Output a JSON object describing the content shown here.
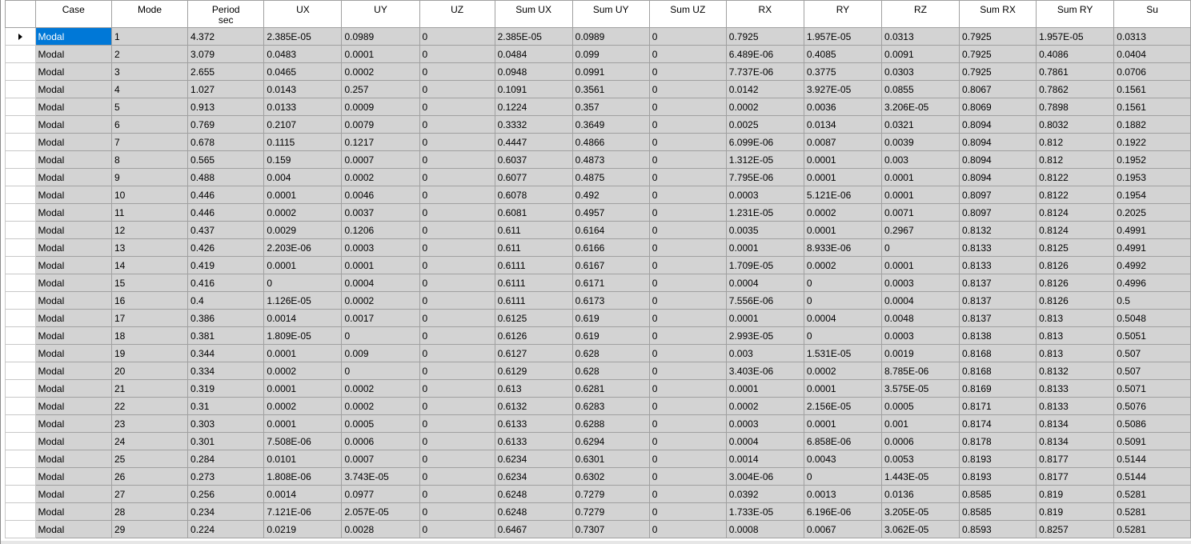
{
  "table": {
    "columns": [
      {
        "label": "Case",
        "sub": ""
      },
      {
        "label": "Mode",
        "sub": ""
      },
      {
        "label": "Period",
        "sub": "sec"
      },
      {
        "label": "UX",
        "sub": ""
      },
      {
        "label": "UY",
        "sub": ""
      },
      {
        "label": "UZ",
        "sub": ""
      },
      {
        "label": "Sum UX",
        "sub": ""
      },
      {
        "label": "Sum UY",
        "sub": ""
      },
      {
        "label": "Sum UZ",
        "sub": ""
      },
      {
        "label": "RX",
        "sub": ""
      },
      {
        "label": "RY",
        "sub": ""
      },
      {
        "label": "RZ",
        "sub": ""
      },
      {
        "label": "Sum RX",
        "sub": ""
      },
      {
        "label": "Sum RY",
        "sub": ""
      },
      {
        "label": "Su",
        "sub": ""
      }
    ],
    "rows": [
      [
        "Modal",
        "1",
        "4.372",
        "2.385E-05",
        "0.0989",
        "0",
        "2.385E-05",
        "0.0989",
        "0",
        "0.7925",
        "1.957E-05",
        "0.0313",
        "0.7925",
        "1.957E-05",
        "0.0313"
      ],
      [
        "Modal",
        "2",
        "3.079",
        "0.0483",
        "0.0001",
        "0",
        "0.0484",
        "0.099",
        "0",
        "6.489E-06",
        "0.4085",
        "0.0091",
        "0.7925",
        "0.4086",
        "0.0404"
      ],
      [
        "Modal",
        "3",
        "2.655",
        "0.0465",
        "0.0002",
        "0",
        "0.0948",
        "0.0991",
        "0",
        "7.737E-06",
        "0.3775",
        "0.0303",
        "0.7925",
        "0.7861",
        "0.0706"
      ],
      [
        "Modal",
        "4",
        "1.027",
        "0.0143",
        "0.257",
        "0",
        "0.1091",
        "0.3561",
        "0",
        "0.0142",
        "3.927E-05",
        "0.0855",
        "0.8067",
        "0.7862",
        "0.1561"
      ],
      [
        "Modal",
        "5",
        "0.913",
        "0.0133",
        "0.0009",
        "0",
        "0.1224",
        "0.357",
        "0",
        "0.0002",
        "0.0036",
        "3.206E-05",
        "0.8069",
        "0.7898",
        "0.1561"
      ],
      [
        "Modal",
        "6",
        "0.769",
        "0.2107",
        "0.0079",
        "0",
        "0.3332",
        "0.3649",
        "0",
        "0.0025",
        "0.0134",
        "0.0321",
        "0.8094",
        "0.8032",
        "0.1882"
      ],
      [
        "Modal",
        "7",
        "0.678",
        "0.1115",
        "0.1217",
        "0",
        "0.4447",
        "0.4866",
        "0",
        "6.099E-06",
        "0.0087",
        "0.0039",
        "0.8094",
        "0.812",
        "0.1922"
      ],
      [
        "Modal",
        "8",
        "0.565",
        "0.159",
        "0.0007",
        "0",
        "0.6037",
        "0.4873",
        "0",
        "1.312E-05",
        "0.0001",
        "0.003",
        "0.8094",
        "0.812",
        "0.1952"
      ],
      [
        "Modal",
        "9",
        "0.488",
        "0.004",
        "0.0002",
        "0",
        "0.6077",
        "0.4875",
        "0",
        "7.795E-06",
        "0.0001",
        "0.0001",
        "0.8094",
        "0.8122",
        "0.1953"
      ],
      [
        "Modal",
        "10",
        "0.446",
        "0.0001",
        "0.0046",
        "0",
        "0.6078",
        "0.492",
        "0",
        "0.0003",
        "5.121E-06",
        "0.0001",
        "0.8097",
        "0.8122",
        "0.1954"
      ],
      [
        "Modal",
        "11",
        "0.446",
        "0.0002",
        "0.0037",
        "0",
        "0.6081",
        "0.4957",
        "0",
        "1.231E-05",
        "0.0002",
        "0.0071",
        "0.8097",
        "0.8124",
        "0.2025"
      ],
      [
        "Modal",
        "12",
        "0.437",
        "0.0029",
        "0.1206",
        "0",
        "0.611",
        "0.6164",
        "0",
        "0.0035",
        "0.0001",
        "0.2967",
        "0.8132",
        "0.8124",
        "0.4991"
      ],
      [
        "Modal",
        "13",
        "0.426",
        "2.203E-06",
        "0.0003",
        "0",
        "0.611",
        "0.6166",
        "0",
        "0.0001",
        "8.933E-06",
        "0",
        "0.8133",
        "0.8125",
        "0.4991"
      ],
      [
        "Modal",
        "14",
        "0.419",
        "0.0001",
        "0.0001",
        "0",
        "0.6111",
        "0.6167",
        "0",
        "1.709E-05",
        "0.0002",
        "0.0001",
        "0.8133",
        "0.8126",
        "0.4992"
      ],
      [
        "Modal",
        "15",
        "0.416",
        "0",
        "0.0004",
        "0",
        "0.6111",
        "0.6171",
        "0",
        "0.0004",
        "0",
        "0.0003",
        "0.8137",
        "0.8126",
        "0.4996"
      ],
      [
        "Modal",
        "16",
        "0.4",
        "1.126E-05",
        "0.0002",
        "0",
        "0.6111",
        "0.6173",
        "0",
        "7.556E-06",
        "0",
        "0.0004",
        "0.8137",
        "0.8126",
        "0.5"
      ],
      [
        "Modal",
        "17",
        "0.386",
        "0.0014",
        "0.0017",
        "0",
        "0.6125",
        "0.619",
        "0",
        "0.0001",
        "0.0004",
        "0.0048",
        "0.8137",
        "0.813",
        "0.5048"
      ],
      [
        "Modal",
        "18",
        "0.381",
        "1.809E-05",
        "0",
        "0",
        "0.6126",
        "0.619",
        "0",
        "2.993E-05",
        "0",
        "0.0003",
        "0.8138",
        "0.813",
        "0.5051"
      ],
      [
        "Modal",
        "19",
        "0.344",
        "0.0001",
        "0.009",
        "0",
        "0.6127",
        "0.628",
        "0",
        "0.003",
        "1.531E-05",
        "0.0019",
        "0.8168",
        "0.813",
        "0.507"
      ],
      [
        "Modal",
        "20",
        "0.334",
        "0.0002",
        "0",
        "0",
        "0.6129",
        "0.628",
        "0",
        "3.403E-06",
        "0.0002",
        "8.785E-06",
        "0.8168",
        "0.8132",
        "0.507"
      ],
      [
        "Modal",
        "21",
        "0.319",
        "0.0001",
        "0.0002",
        "0",
        "0.613",
        "0.6281",
        "0",
        "0.0001",
        "0.0001",
        "3.575E-05",
        "0.8169",
        "0.8133",
        "0.5071"
      ],
      [
        "Modal",
        "22",
        "0.31",
        "0.0002",
        "0.0002",
        "0",
        "0.6132",
        "0.6283",
        "0",
        "0.0002",
        "2.156E-05",
        "0.0005",
        "0.8171",
        "0.8133",
        "0.5076"
      ],
      [
        "Modal",
        "23",
        "0.303",
        "0.0001",
        "0.0005",
        "0",
        "0.6133",
        "0.6288",
        "0",
        "0.0003",
        "0.0001",
        "0.001",
        "0.8174",
        "0.8134",
        "0.5086"
      ],
      [
        "Modal",
        "24",
        "0.301",
        "7.508E-06",
        "0.0006",
        "0",
        "0.6133",
        "0.6294",
        "0",
        "0.0004",
        "6.858E-06",
        "0.0006",
        "0.8178",
        "0.8134",
        "0.5091"
      ],
      [
        "Modal",
        "25",
        "0.284",
        "0.0101",
        "0.0007",
        "0",
        "0.6234",
        "0.6301",
        "0",
        "0.0014",
        "0.0043",
        "0.0053",
        "0.8193",
        "0.8177",
        "0.5144"
      ],
      [
        "Modal",
        "26",
        "0.273",
        "1.808E-06",
        "3.743E-05",
        "0",
        "0.6234",
        "0.6302",
        "0",
        "3.004E-06",
        "0",
        "1.443E-05",
        "0.8193",
        "0.8177",
        "0.5144"
      ],
      [
        "Modal",
        "27",
        "0.256",
        "0.0014",
        "0.0977",
        "0",
        "0.6248",
        "0.7279",
        "0",
        "0.0392",
        "0.0013",
        "0.0136",
        "0.8585",
        "0.819",
        "0.5281"
      ],
      [
        "Modal",
        "28",
        "0.234",
        "7.121E-06",
        "2.057E-05",
        "0",
        "0.6248",
        "0.7279",
        "0",
        "1.733E-05",
        "6.196E-06",
        "3.205E-05",
        "0.8585",
        "0.819",
        "0.5281"
      ],
      [
        "Modal",
        "29",
        "0.224",
        "0.0219",
        "0.0028",
        "0",
        "0.6467",
        "0.7307",
        "0",
        "0.0008",
        "0.0067",
        "3.062E-05",
        "0.8593",
        "0.8257",
        "0.5281"
      ]
    ]
  },
  "colors": {
    "selected_bg": "#0078d7",
    "selected_fg": "#ffffff",
    "cell_bg": "#d3d3d3",
    "grid_line": "#a0a0a0"
  },
  "icons": {
    "current_row": "triangle-right-icon"
  }
}
